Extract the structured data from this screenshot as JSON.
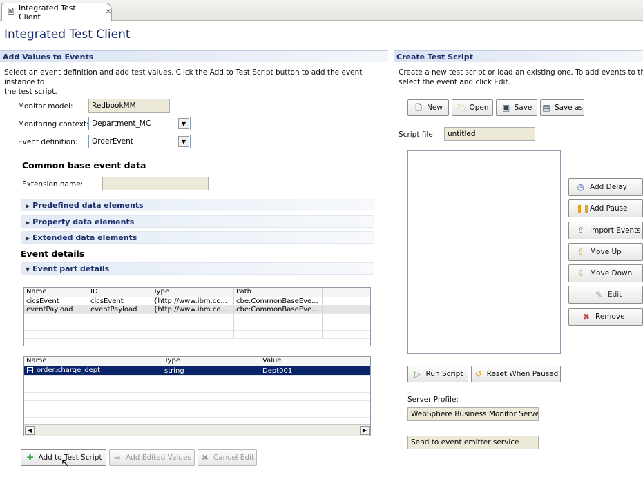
{
  "tab": {
    "label": "Integrated Test Client",
    "close": "✕"
  },
  "page_title": "Integrated Test Client",
  "left": {
    "header": "Add Values to Events",
    "description_line1": "Select an event definition and add test values. Click the Add to Test Script button to add the event instance to",
    "description_line2": "the test script.",
    "monitor_model": {
      "label": "Monitor model:",
      "value": "RedbookMM"
    },
    "monitoring_context": {
      "label": "Monitoring context:",
      "value": "Department_MC"
    },
    "event_definition": {
      "label": "Event definition:",
      "value": "OrderEvent"
    },
    "cbe_heading": "Common base event data",
    "extension_name": {
      "label": "Extension name:",
      "value": ""
    },
    "sections": {
      "predefined": "Predefined data elements",
      "property": "Property data elements",
      "extended": "Extended data elements"
    },
    "event_details_heading": "Event details",
    "event_part_details": "Event part details",
    "parts_table": {
      "columns": [
        "Name",
        "ID",
        "Type",
        "Path"
      ],
      "rows": [
        [
          "cicsEvent",
          "cicsEvent",
          "{http://www.ibm.co...",
          "cbe:CommonBaseEve..."
        ],
        [
          "eventPayload",
          "eventPayload",
          "{http://www.ibm.co...",
          "cbe:CommonBaseEve..."
        ]
      ]
    },
    "values_table": {
      "columns": [
        "Name",
        "Type",
        "Value"
      ],
      "rows": [
        [
          "order:charge_dept",
          "string",
          "Dept001"
        ]
      ]
    },
    "buttons": {
      "add_to_script": "Add to Test Script",
      "add_edited": "Add Edited Values",
      "cancel_edit": "Cancel Edit"
    }
  },
  "right": {
    "header": "Create Test Script",
    "description_line1": "Create a new test script or load an existing one. To add events to the scr",
    "description_line2": "select the event and click Edit.",
    "toolbar": {
      "new": "New",
      "open": "Open",
      "save": "Save",
      "save_as": "Save as"
    },
    "script_file": {
      "label": "Script file:",
      "value": "untitled"
    },
    "side_buttons": {
      "add_delay": "Add Delay",
      "add_pause": "Add Pause",
      "import_events": "Import Events",
      "move_up": "Move Up",
      "move_down": "Move Down",
      "edit": "Edit",
      "remove": "Remove"
    },
    "run_script": "Run Script",
    "reset_when_paused": "Reset When Paused",
    "server_profile": {
      "label": "Server Profile:",
      "value": "WebSphere Business Monitor Server \\"
    },
    "send_to": "Send to event emitter service"
  },
  "colors": {
    "header_text": "#1b2f6b",
    "selection": "#0a246a"
  }
}
